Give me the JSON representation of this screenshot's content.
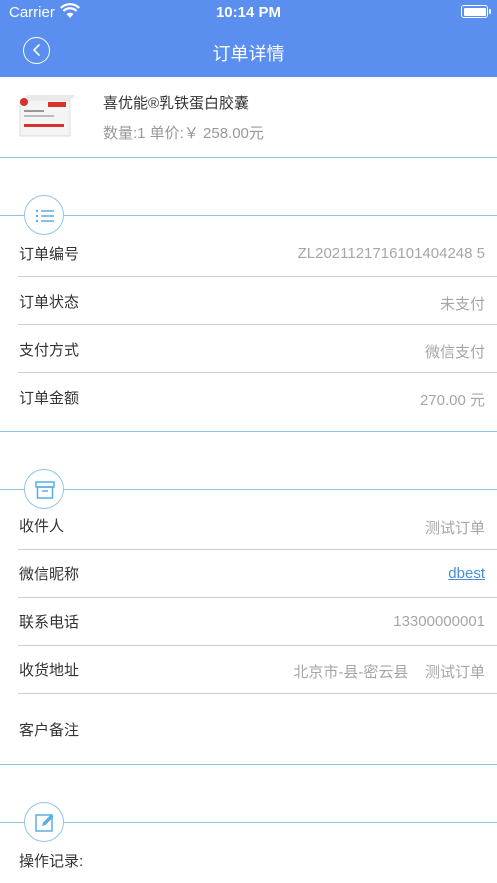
{
  "status_bar": {
    "carrier": "Carrier",
    "time": "10:14 PM"
  },
  "nav": {
    "title": "订单详情",
    "back_icon": "chevron-left-icon"
  },
  "product": {
    "name": "喜优能®乳铁蛋白胶囊",
    "meta": "数量:1 单价:￥ 258.00元"
  },
  "order_section": {
    "icon": "list-icon",
    "rows": [
      {
        "label": "订单编号",
        "value": "ZL2021121716101404248 5"
      },
      {
        "label": "订单状态",
        "value": "未支付"
      },
      {
        "label": "支付方式",
        "value": "微信支付"
      },
      {
        "label": "订单金额",
        "value": "270.00 元"
      }
    ]
  },
  "receiver_section": {
    "icon": "archive-box-icon",
    "rows": [
      {
        "label": "收件人",
        "value": "测试订单"
      },
      {
        "label": "微信昵称",
        "value": "dbest"
      },
      {
        "label": "联系电话",
        "value": "13300000001"
      },
      {
        "label": "收货地址",
        "value": "北京市-县-密云县    测试订单"
      },
      {
        "label": "客户备注",
        "value": ""
      }
    ]
  },
  "log_section": {
    "icon": "edit-icon",
    "label": "操作记录:"
  },
  "colors": {
    "header": "#5a8ff0",
    "divider": "#8fc5e8",
    "link": "#4a8fd6"
  }
}
